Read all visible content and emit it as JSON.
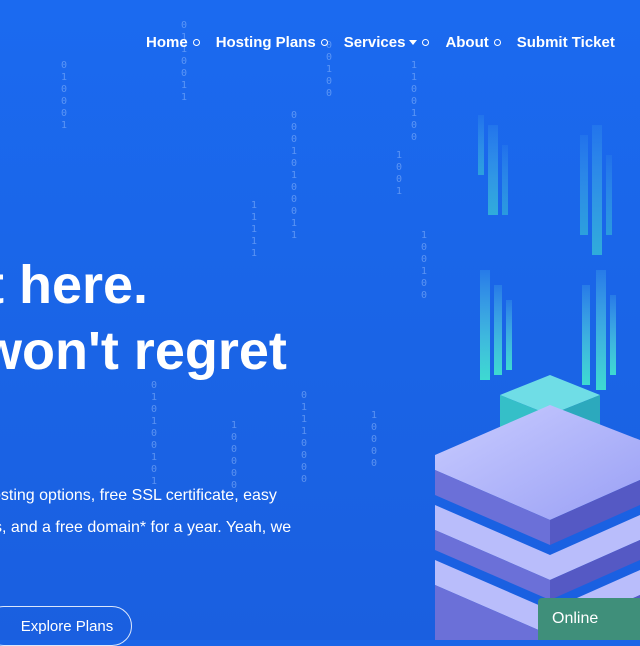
{
  "nav": {
    "items": [
      {
        "label": "Home",
        "has_caret": false
      },
      {
        "label": "Hosting Plans",
        "has_caret": false
      },
      {
        "label": "Services",
        "has_caret": true
      },
      {
        "label": "About",
        "has_caret": false
      },
      {
        "label": "Submit Ticket",
        "has_caret": false
      }
    ]
  },
  "hero": {
    "headline_line1": "t here.",
    "headline_line2": "won't regret",
    "sub_line1": "osting options, free SSL certificate, easy",
    "sub_line2": "s, and a free domain* for a year. Yeah, we",
    "cta_label": "Explore Plans"
  },
  "chat": {
    "status_label": "Online"
  },
  "colors": {
    "background": "#1a66e8",
    "accent_teal": "#3fe0d0",
    "badge": "#3f8f7a",
    "server_lavender": "#8f96f0"
  },
  "icons": [
    "dropdown-caret-icon",
    "nav-dot-icon"
  ]
}
